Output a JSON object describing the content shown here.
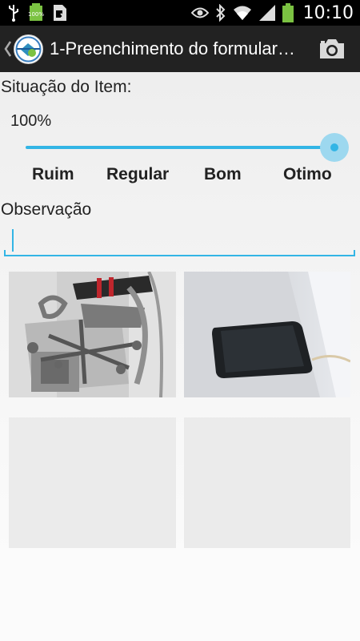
{
  "status_bar": {
    "time": "10:10",
    "battery_text": "100%",
    "icons": [
      "usb-icon",
      "battery-full-small-icon",
      "sim-card-icon",
      "eye-icon",
      "bluetooth-icon",
      "wifi-icon",
      "signal-icon",
      "battery-icon"
    ]
  },
  "action_bar": {
    "title": "1-Preenchimento do formulario...",
    "icons": [
      "back-chevron-icon",
      "app-logo-icon",
      "camera-icon"
    ]
  },
  "form": {
    "situacao_label": "Situação do Item:",
    "percent_text": "100%",
    "slider_value_fraction": 1.0,
    "levels": [
      "Ruim",
      "Regular",
      "Bom",
      "Otimo"
    ],
    "observacao_label": "Observação",
    "observacao_value": ""
  },
  "photos": {
    "slots": [
      "photo-with-object",
      "photo-with-phone",
      "empty",
      "empty"
    ]
  },
  "colors": {
    "accent": "#33b5e5",
    "action_bar_bg": "#222222",
    "status_bar_bg": "#000000"
  }
}
